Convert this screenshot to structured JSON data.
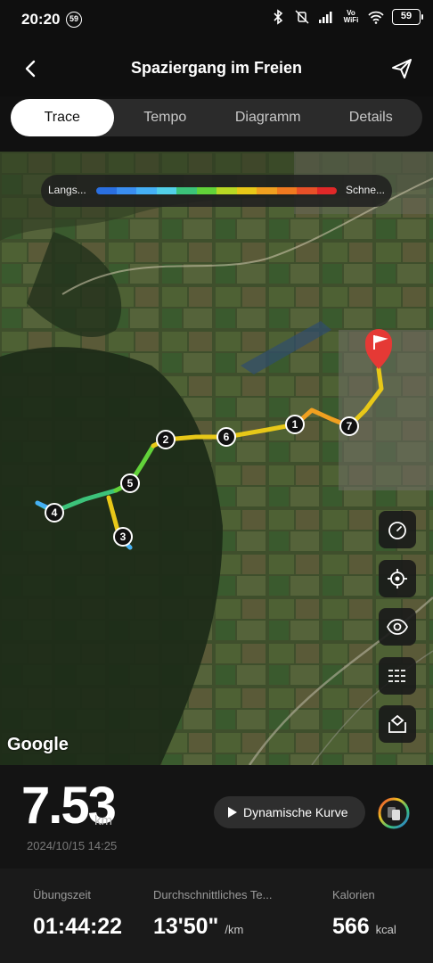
{
  "status_bar": {
    "time": "20:20",
    "notification_badge": "59",
    "vowifi": "Vo WiFi",
    "battery": "59",
    "icons": [
      "bluetooth-icon",
      "mute-vibrate-icon",
      "signal-icon",
      "wifi-icon"
    ]
  },
  "header": {
    "title": "Spaziergang im Freien",
    "back_icon": "chevron-left-icon",
    "share_icon": "send-icon"
  },
  "tabs": [
    {
      "label": "Trace",
      "active": true
    },
    {
      "label": "Tempo",
      "active": false
    },
    {
      "label": "Diagramm",
      "active": false
    },
    {
      "label": "Details",
      "active": false
    }
  ],
  "map": {
    "legend_slow": "Langs...",
    "legend_fast": "Schne...",
    "legend_colors": [
      "#2a6fe0",
      "#3a8ef0",
      "#45b0f5",
      "#52d0e8",
      "#3cc37a",
      "#62d23a",
      "#b8d824",
      "#e8c818",
      "#f0a020",
      "#f07a20",
      "#e85028",
      "#e02828"
    ],
    "markers": [
      "1",
      "2",
      "3",
      "4",
      "5",
      "6",
      "7"
    ],
    "google_label": "Google",
    "controls": [
      "speedometer-icon",
      "locate-icon",
      "eye-icon",
      "list-icon",
      "map-layer-icon"
    ]
  },
  "summary": {
    "distance": "7.53",
    "distance_unit": "km",
    "datetime": "2024/10/15 14:25",
    "dynamic_button": "Dynamische Kurve"
  },
  "stats": [
    {
      "label": "Übungszeit",
      "value": "01:44:22",
      "unit": ""
    },
    {
      "label": "Durchschnittliches Te...",
      "value": "13'50\"",
      "unit": "/km"
    },
    {
      "label": "Kalorien",
      "value": "566",
      "unit": "kcal"
    }
  ]
}
